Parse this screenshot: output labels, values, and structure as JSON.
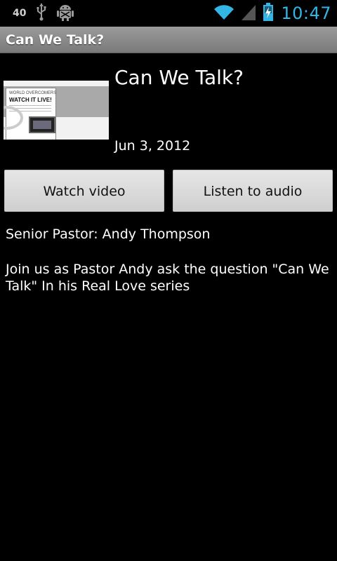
{
  "status_bar": {
    "notification_count": "40",
    "time": "10:47",
    "icons": [
      "usb-icon",
      "android-debug-icon",
      "wifi-icon",
      "signal-icon",
      "battery-charging-icon"
    ],
    "time_color": "#33b5e5"
  },
  "title_bar": {
    "title": "Can We Talk?"
  },
  "item": {
    "title": "Can We Talk?",
    "date": "Jun 3, 2012",
    "thumbnail": {
      "line1": "WORLD OVERCOMERS",
      "line2": "WATCH IT LIVE!"
    }
  },
  "actions": {
    "watch_label": "Watch video",
    "listen_label": "Listen to audio"
  },
  "details": {
    "speaker": "Senior Pastor: Andy Thompson",
    "description": "Join us as Pastor Andy ask the question \"Can We Talk\" In his Real Love series"
  }
}
